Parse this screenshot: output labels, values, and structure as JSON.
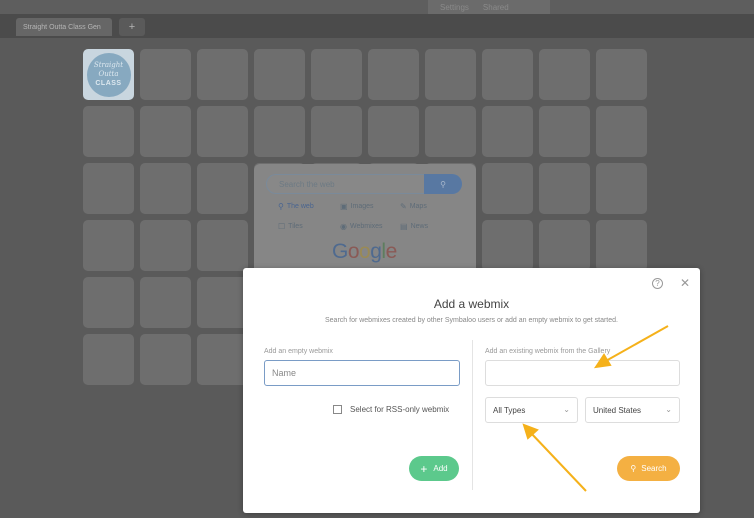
{
  "topmenu": {
    "items": [
      "Settings",
      "Shared"
    ]
  },
  "tabs": {
    "active_label": "Straight Outta Class Gen",
    "add_label": "+"
  },
  "logo_tile": {
    "line1": "Straight",
    "line2": "Outta",
    "line3": "CLASS"
  },
  "google_search": {
    "placeholder": "Search the web",
    "options": [
      {
        "icon": "search-icon",
        "label": "The web",
        "selected": true
      },
      {
        "icon": "image-icon",
        "label": "Images",
        "selected": false
      },
      {
        "icon": "map-icon",
        "label": "Maps",
        "selected": false
      },
      {
        "icon": "square-icon",
        "label": "Tiles",
        "selected": false
      },
      {
        "icon": "radio-icon",
        "label": "Webmixes",
        "selected": false
      },
      {
        "icon": "news-icon",
        "label": "News",
        "selected": false
      }
    ],
    "logo_text": "Google"
  },
  "modal": {
    "title": "Add a webmix",
    "subtitle": "Search for webmixes created by other Symbaloo users or add an empty webmix to get started.",
    "left": {
      "label": "Add an empty webmix",
      "name_placeholder": "Name",
      "rss_label": "Select for RSS-only webmix",
      "add_button": "Add"
    },
    "right": {
      "label": "Add an existing webmix from the Gallery",
      "type_select": "All Types",
      "country_select": "United States",
      "search_button": "Search"
    }
  },
  "colors": {
    "add_green": "#5cc98c",
    "search_orange": "#f4b042",
    "annotation_arrow": "#f5b11a"
  }
}
